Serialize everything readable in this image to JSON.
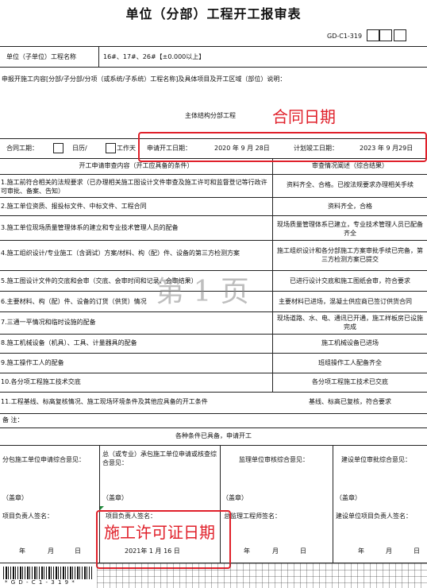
{
  "title": "单位（分部）工程开工报审表",
  "code": "GD-C1-319",
  "unit_label": "单位（子单位）工程名称",
  "unit_value": "16#、17#、26#【±0.000以上】",
  "content_label": "申报开施工内容[分部/子分部/分项（或系统/子系统）工程名称]及具体项目及开工区域（部位）说明：",
  "content_value": "主体结构分部工程",
  "annot_contract": "合同日期",
  "period": {
    "contract_label": "合同工期：",
    "days_label": "日历/",
    "workday_label": "工作天",
    "apply_label": "申请开工日期：",
    "apply_date": "2020 年  9 月 28日",
    "plan_label": "计划竣工日期：",
    "plan_date": "2023 年  9 月29日"
  },
  "checklist": {
    "header_left": "开工申请审查内容（开工应具备的条件）",
    "header_right": "审查情况阐述（综合结果）",
    "rows": [
      {
        "item": "1.施工前符合相关的法规要求（已办理相关施工图设计文件审查及施工许可和监督登记等行政许可审批、备案、告知）",
        "result": "资料齐全、合格。已按法规要求办理相关手续"
      },
      {
        "item": "2.施工单位资质、报投标文件、中标文件、工程合同",
        "result": "资料齐全，合格"
      },
      {
        "item": "3.施工单位现场质量管理体系的建立和专业技术管理人员的配备",
        "result": "现场质量管理体系已建立，专业技术管理人员已配备齐全"
      },
      {
        "item": "4.施工组织设计/专业施工（含调试）方案/材料、构（配）件、设备的第三方检测方案",
        "result": "施工组织设计和各分部施工方案审批手续已完备，第三方检测方案已提交"
      },
      {
        "item": "5.施工图设计文件的交底和会审（交底、会审时间和记录、会审结果）",
        "result": "已进行设计交底和施工图纸会审，符合要求"
      },
      {
        "item": "6.主要材料、构（配）件、设备的订货（供货）情况",
        "result": "主要材料已进场，混凝土供应商已签订供货合同"
      },
      {
        "item": "7.三通一平情况和临时设施的配备",
        "result": "现场道路、水、电、通讯已开通，施工样板房已设施完成"
      },
      {
        "item": "8.施工机械设备（机具）、工具、计量器具的配备",
        "result": "施工机械设备已进场"
      },
      {
        "item": "9.施工操作工人的配备",
        "result": "班组操作工人配备齐全"
      },
      {
        "item": "10.各分项工程施工技术交底",
        "result": "各分项工程施工技术已交底"
      },
      {
        "item": "11.工程基线、标高复核情况、施工现场环境条件及其他应具备的开工条件",
        "result": "基线、标高已复核，符合要求"
      }
    ]
  },
  "remark_label": "备 注：",
  "conditions_text": "各种条件已具备，申请开工",
  "opinions": [
    {
      "heading": "分包施工单位申请综合意见：",
      "seal": "（盖章）",
      "sign": "项目负责人签名："
    },
    {
      "heading": "总（或专业）承包施工单位申请或核查综合意见：",
      "seal": "（盖章）",
      "sign": "项目负责人签名："
    },
    {
      "heading": "监理单位审核综合意见：",
      "seal": "（盖章）",
      "sign": "总监理工程师签名："
    },
    {
      "heading": "建设单位审批综合意见：",
      "seal": "（盖章）",
      "sign": "建设单位项目负责人签名："
    }
  ],
  "date_units": {
    "year": "年",
    "month": "月",
    "day": "日"
  },
  "contractor_date": "2021年   1 月 16 日",
  "annot_permit": "施工许可证日期",
  "watermark": "第 1 页",
  "barcode_text": "* G D - C 1 - 3 1 9 *"
}
